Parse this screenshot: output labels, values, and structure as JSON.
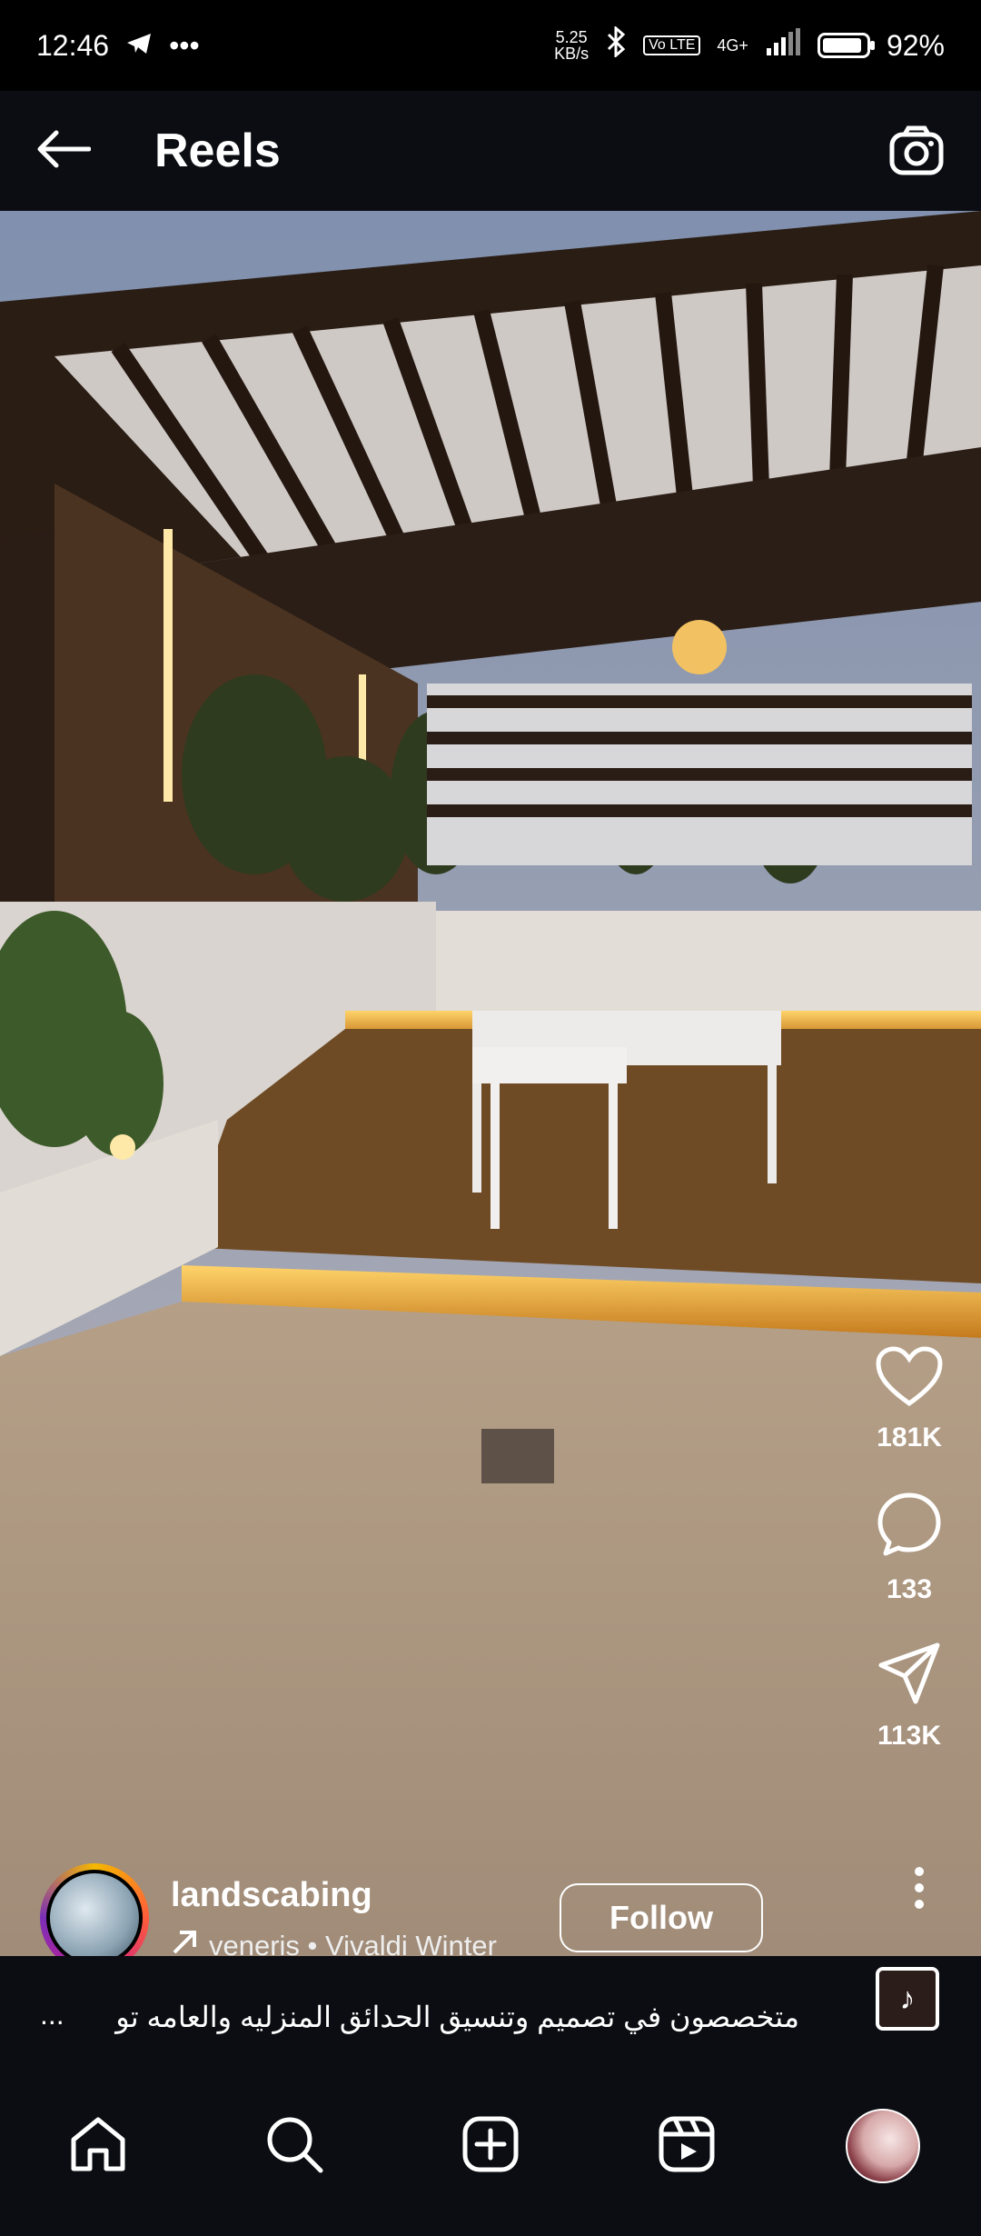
{
  "status_bar": {
    "time": "12:46",
    "speed_value": "5.25",
    "speed_unit": "KB/s",
    "volte_badge": "Vo LTE",
    "network": "4G+",
    "battery": "92%",
    "battery_level": 0.92
  },
  "header": {
    "title": "Reels"
  },
  "video": {
    "description": "rooftop pergola with lighting"
  },
  "actions": {
    "likes": "181K",
    "comments": "133",
    "shares": "113K"
  },
  "author": {
    "username": "landscabing",
    "music": "veneris • Vivaldi Winter",
    "follow_label": "Follow"
  },
  "caption": {
    "text": "متخصصون في تصميم وتنسيق الحدائق المنزليه والعامه تو",
    "more": "..."
  },
  "icons": {
    "back": "arrow-left-icon",
    "camera": "camera-icon",
    "like": "heart-icon",
    "comment": "comment-icon",
    "share": "send-icon",
    "more": "more-vertical-icon",
    "home": "home-icon",
    "search": "search-icon",
    "create": "plus-square-icon",
    "reels": "reels-icon"
  }
}
